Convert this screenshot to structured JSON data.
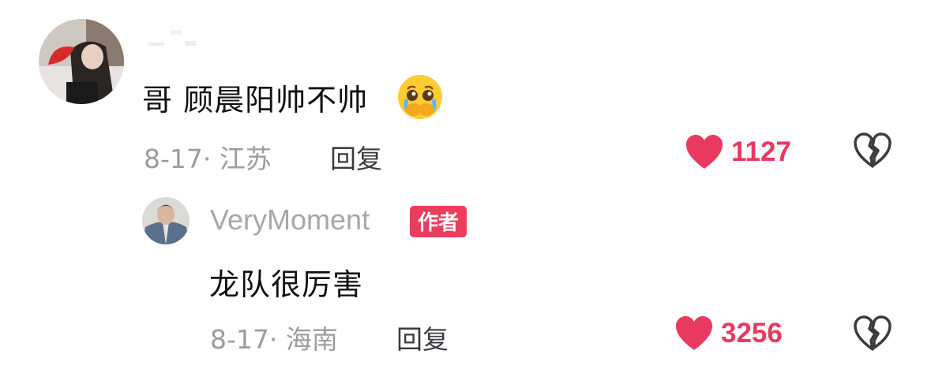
{
  "comment": {
    "avatar": "avatar",
    "text": "哥 顾晨阳帅不帅",
    "emoji": "crying-face-emoji",
    "date_location": "8-17· 江苏",
    "reply_label": "回复",
    "like_count": "1127"
  },
  "reply": {
    "avatar": "avatar",
    "username": "VeryMoment",
    "author_badge": "作者",
    "text": "龙队很厉害",
    "date_location": "8-17· 海南",
    "reply_label": "回复",
    "like_count": "3256"
  },
  "colors": {
    "accent": "#e8395f",
    "badge": "#ec3d5c",
    "meta_text": "#9c9ca0",
    "username": "#a7a7ab"
  },
  "icons": [
    "heart-icon",
    "dislike-broken-heart-icon"
  ]
}
